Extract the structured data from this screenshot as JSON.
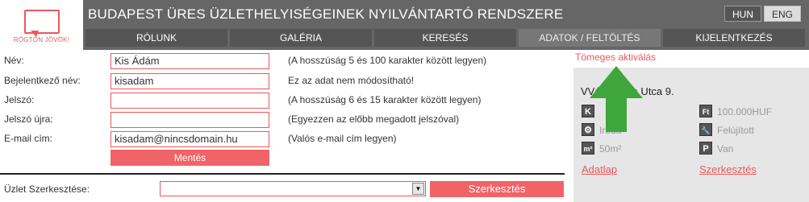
{
  "logo": {
    "text": "RÖGTÖN JÖVÖK!"
  },
  "header": {
    "title": "BUDAPEST ÜRES ÜZLETHELYISÉGEINEK NYILVÁNTARTÓ RENDSZERE"
  },
  "languages": [
    {
      "label": "HUN",
      "active": true
    },
    {
      "label": "ENG",
      "active": false
    }
  ],
  "nav": [
    {
      "label": "RÓLUNK"
    },
    {
      "label": "GALÉRIA"
    },
    {
      "label": "KERESÉS"
    },
    {
      "label": "ADATOK / FELTÖLTÉS",
      "active": true
    },
    {
      "label": "KIJELENTKEZÉS"
    }
  ],
  "form": {
    "fields": [
      {
        "label": "Név:",
        "value": "Kis Ádám",
        "hint": "(A hosszúság 5 és 100 karakter között legyen)"
      },
      {
        "label": "Bejelentkező név:",
        "value": "kisadam",
        "hint": "Ez az adat nem módosítható!"
      },
      {
        "label": "Jelszó:",
        "value": "",
        "hint": "(A hosszúság 6 és 15 karakter között legyen)"
      },
      {
        "label": "Jelszó újra:",
        "value": "",
        "hint": "(Egyezzen az előbb megadott jelszóval)"
      },
      {
        "label": "E-mail cím:",
        "value": "kisadam@nincsdomain.hu",
        "hint": "(Valós e-mail cím legyen)"
      }
    ],
    "save_label": "Mentés"
  },
  "shop_edit": {
    "label": "Üzlet Szerkesztése:",
    "selected": "",
    "button_label": "Szerkesztés"
  },
  "side": {
    "mass_activate": "Tömeges aktiválás",
    "address": "Városháza Utca 9.",
    "features": [
      {
        "icon": "K",
        "icon_name": "k-icon",
        "text": ""
      },
      {
        "icon": "Ft",
        "icon_name": "price-icon",
        "text": "100.000HUF"
      },
      {
        "icon": "⚙",
        "icon_name": "gear-icon",
        "text": "Iroda"
      },
      {
        "icon": "🔧",
        "icon_name": "wrench-icon",
        "text": "Felújított"
      },
      {
        "icon": "m²",
        "icon_name": "area-icon",
        "text": "50m²"
      },
      {
        "icon": "P",
        "icon_name": "parking-icon",
        "text": "Van"
      }
    ],
    "datasheet_link": "Adatlap",
    "edit_link": "Szerkesztés"
  },
  "colors": {
    "accent": "#e8585d",
    "header": "#666666",
    "nav": "#555555",
    "panel": "#e6e6e6",
    "arrow": "#3ea63a"
  }
}
